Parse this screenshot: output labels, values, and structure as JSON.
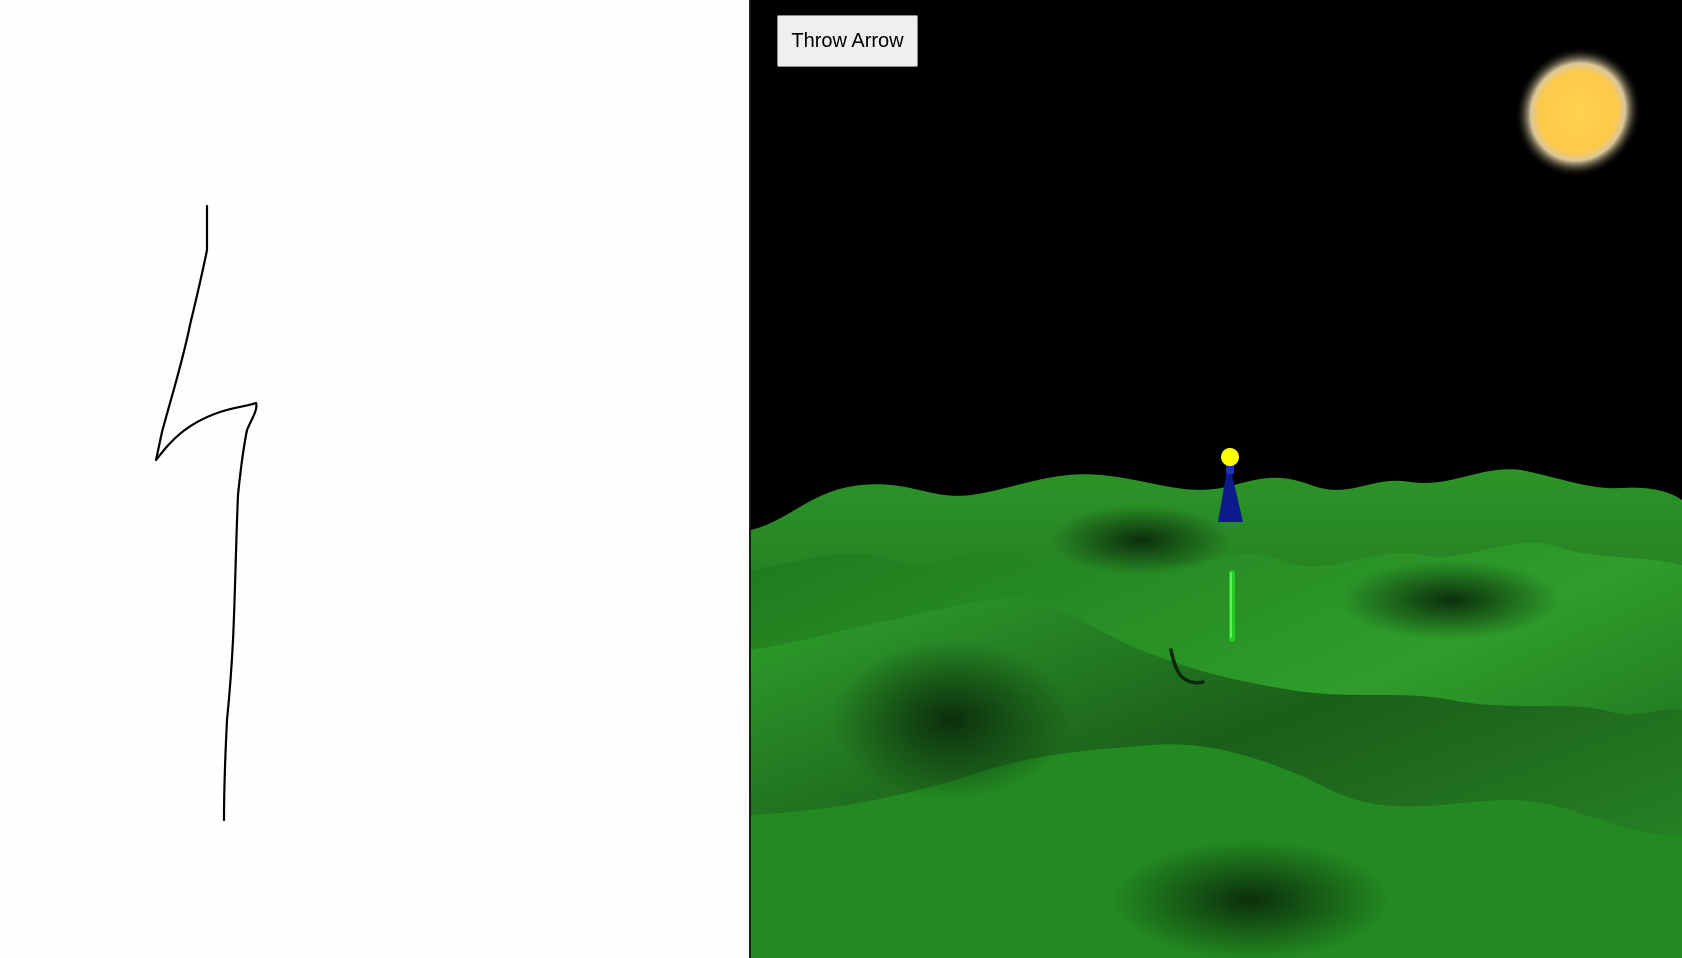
{
  "controls": {
    "throw_button_label": "Throw Arrow"
  },
  "drawing": {
    "stroke_color": "#000000",
    "background_color": "#fefefe"
  },
  "scene": {
    "sky_color": "#000000",
    "sun_color": "#ffc94a",
    "terrain_color": "#2e9a2a",
    "player_head_color": "#ffff00",
    "player_body_color": "#001a8c",
    "arrow_color": "#22cc22"
  },
  "icons": {
    "sun": "sun-icon",
    "player": "player-figure",
    "arrow": "arrow-object"
  }
}
